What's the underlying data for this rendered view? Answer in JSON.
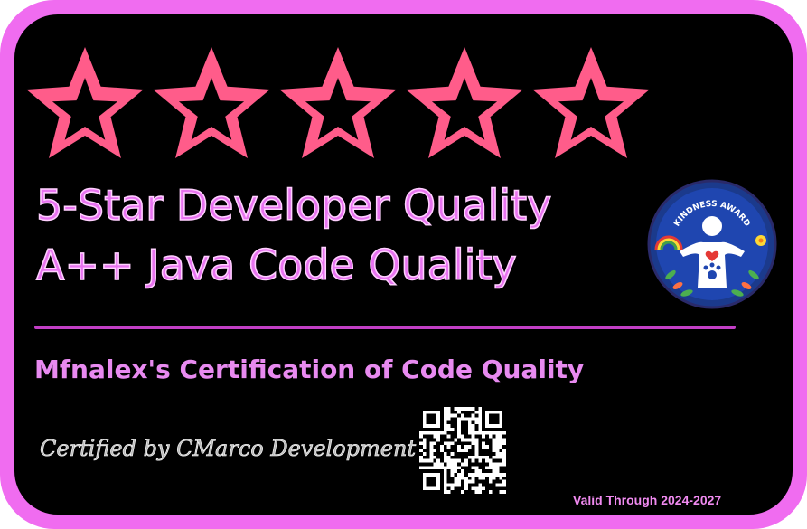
{
  "rating": {
    "stars": 5,
    "max_stars": 5
  },
  "headline": {
    "line1": "5-Star Developer Quality",
    "line2": "A++ Java Code Quality"
  },
  "badge": {
    "text": "KINDNESS AWARD",
    "icon": "kindness-award-patch"
  },
  "certification": {
    "title": "Mfnalex's Certification of Code Quality",
    "certified_by": "Certified by CMarco Development",
    "valid_through": "Valid Through 2024-2027"
  },
  "colors": {
    "border": "#f06cf0",
    "background": "#000000",
    "star": "#ff5c8a",
    "headline": "#e873f0",
    "divider": "#c23fc6"
  }
}
